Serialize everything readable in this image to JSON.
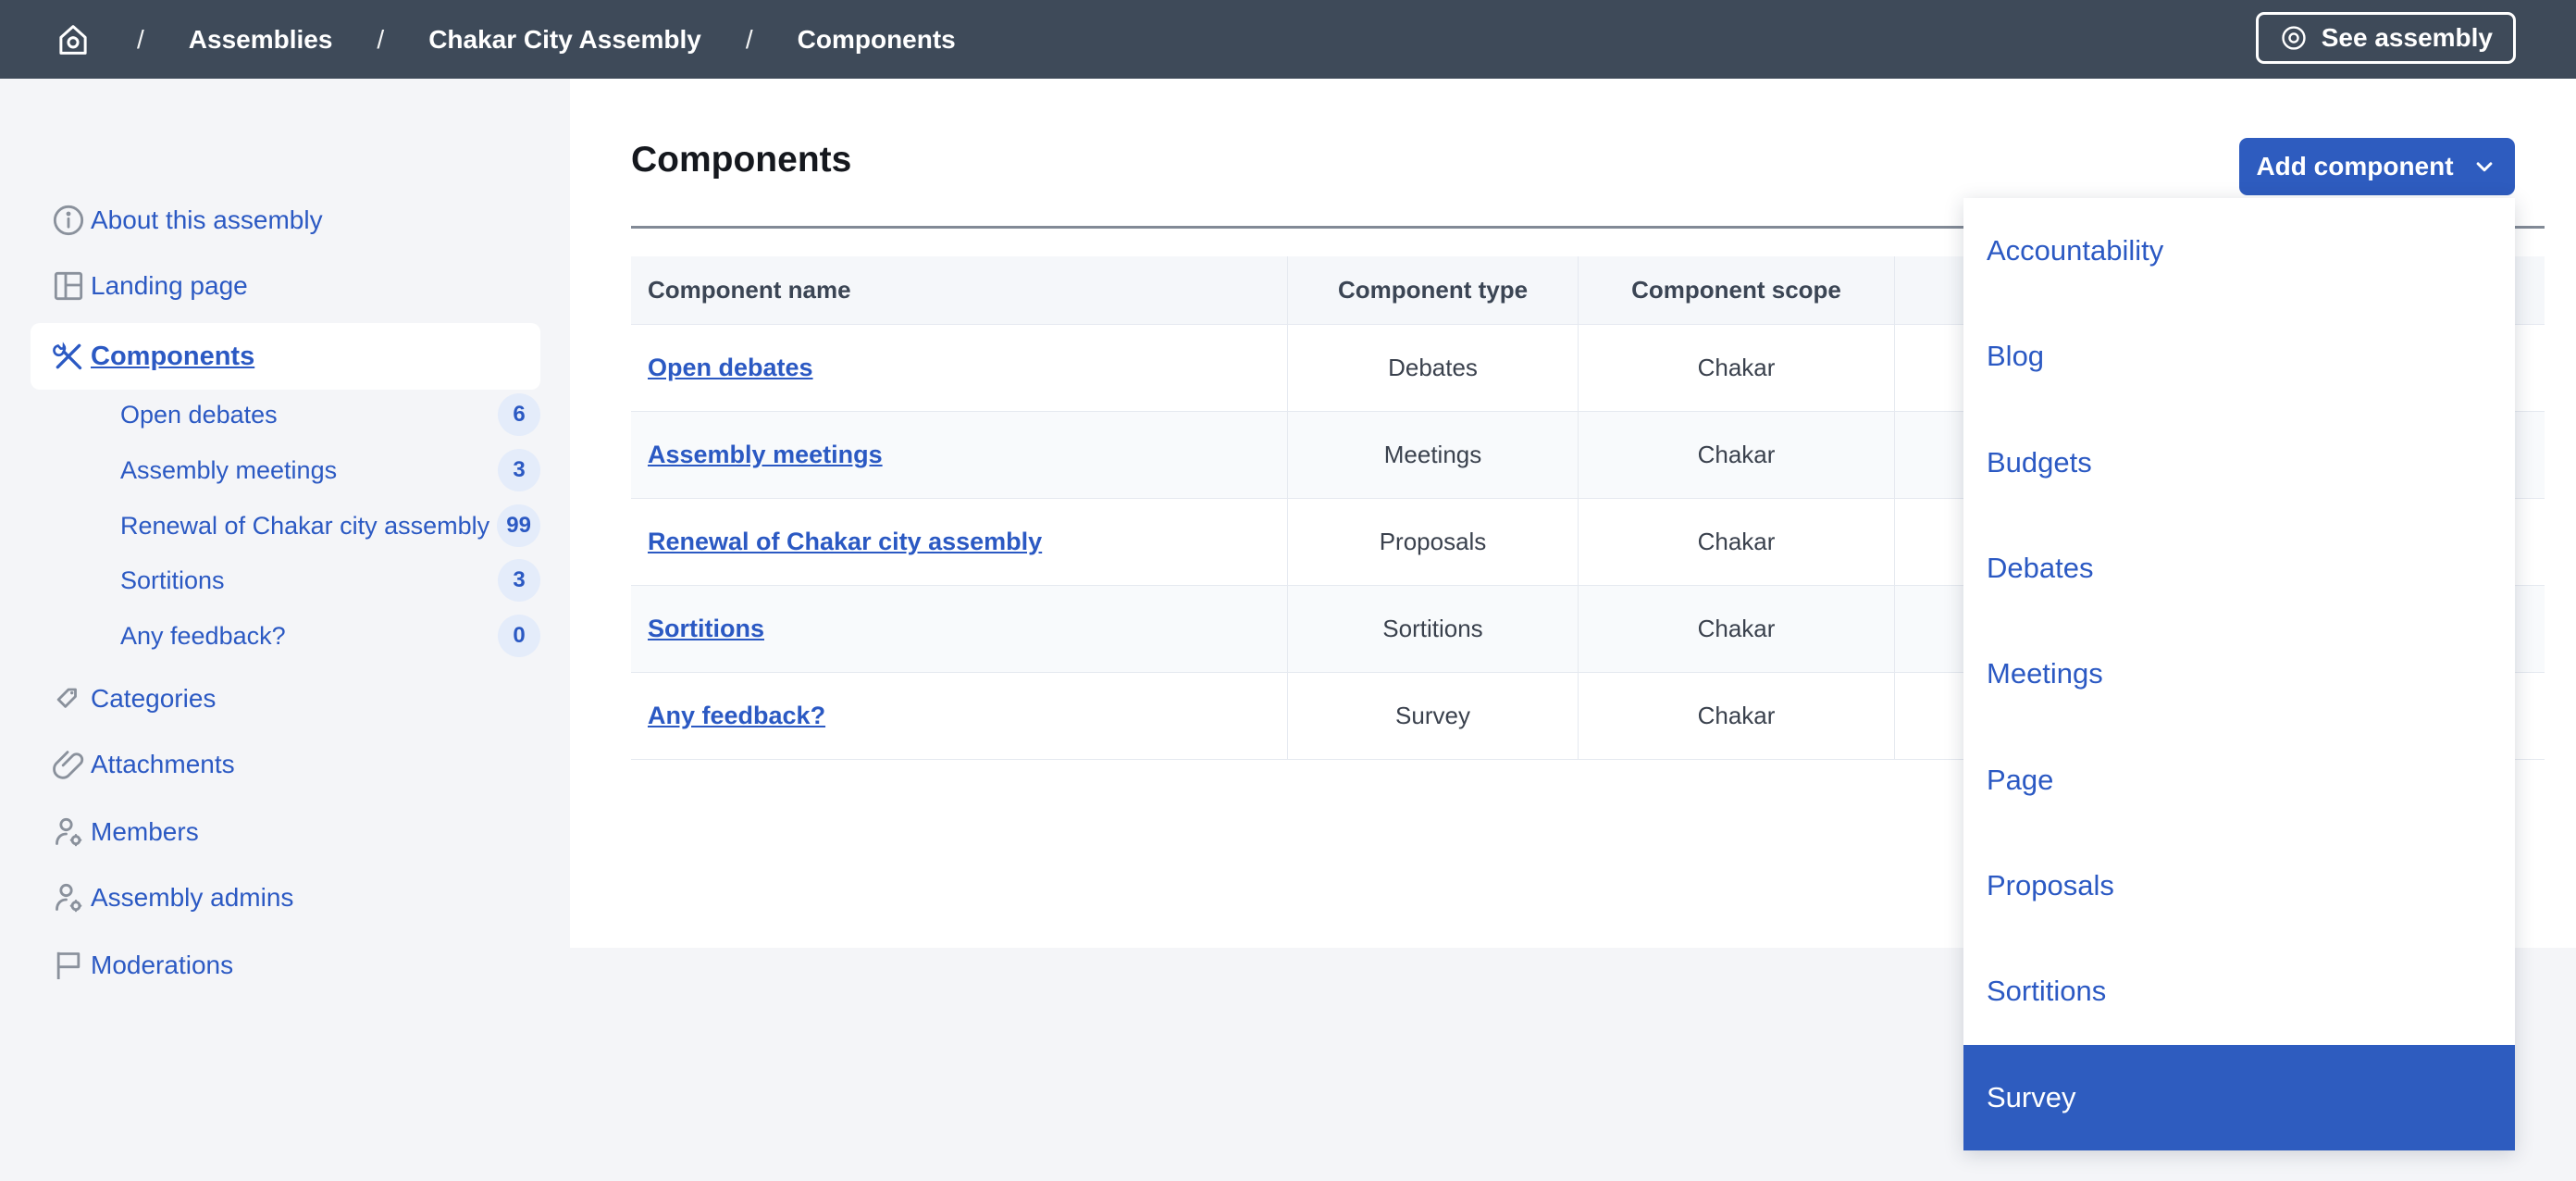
{
  "colors": {
    "topbar_bg": "#3e4a59",
    "primary_blue": "#2e5cbf",
    "link_blue": "#2b59c3",
    "badge_bg": "#e4ecfa",
    "page_bg": "#f4f5f8",
    "selected_item_bg": "#ffffff"
  },
  "topbar": {
    "home_icon": "home-icon",
    "separator": "/",
    "breadcrumb": [
      "Assemblies",
      "Chakar City Assembly",
      "Components"
    ],
    "see_assembly": {
      "icon": "eye-icon",
      "label": "See assembly"
    }
  },
  "sidebar": {
    "items": [
      {
        "label": "About this assembly",
        "icon": "info-icon"
      },
      {
        "label": "Landing page",
        "icon": "landing-page-icon"
      },
      {
        "label": "Components",
        "icon": "tools-icon",
        "selected": true
      },
      {
        "label": "Categories",
        "icon": "tag-icon"
      },
      {
        "label": "Attachments",
        "icon": "paperclip-icon"
      },
      {
        "label": "Members",
        "icon": "person-gear-icon"
      },
      {
        "label": "Assembly admins",
        "icon": "person-gear-icon"
      },
      {
        "label": "Moderations",
        "icon": "flag-icon"
      }
    ],
    "subitems": [
      {
        "label": "Open debates",
        "badge": "6"
      },
      {
        "label": "Assembly meetings",
        "badge": "3"
      },
      {
        "label": "Renewal of Chakar city assembly",
        "badge": "99"
      },
      {
        "label": "Sortitions",
        "badge": "3"
      },
      {
        "label": "Any feedback?",
        "badge": "0"
      }
    ]
  },
  "main": {
    "title": "Components",
    "add_button": {
      "label": "Add component",
      "icon": "chevron-down-icon"
    },
    "table": {
      "headers": [
        "Component name",
        "Component type",
        "Component scope"
      ],
      "rows": [
        {
          "name": "Open debates",
          "type": "Debates",
          "scope": "Chakar"
        },
        {
          "name": "Assembly meetings",
          "type": "Meetings",
          "scope": "Chakar"
        },
        {
          "name": "Renewal of Chakar city assembly",
          "type": "Proposals",
          "scope": "Chakar"
        },
        {
          "name": "Sortitions",
          "type": "Sortitions",
          "scope": "Chakar"
        },
        {
          "name": "Any feedback?",
          "type": "Survey",
          "scope": "Chakar"
        }
      ]
    }
  },
  "dropdown": {
    "items": [
      "Accountability",
      "Blog",
      "Budgets",
      "Debates",
      "Meetings",
      "Page",
      "Proposals",
      "Sortitions",
      "Survey"
    ],
    "highlighted": "Survey"
  }
}
